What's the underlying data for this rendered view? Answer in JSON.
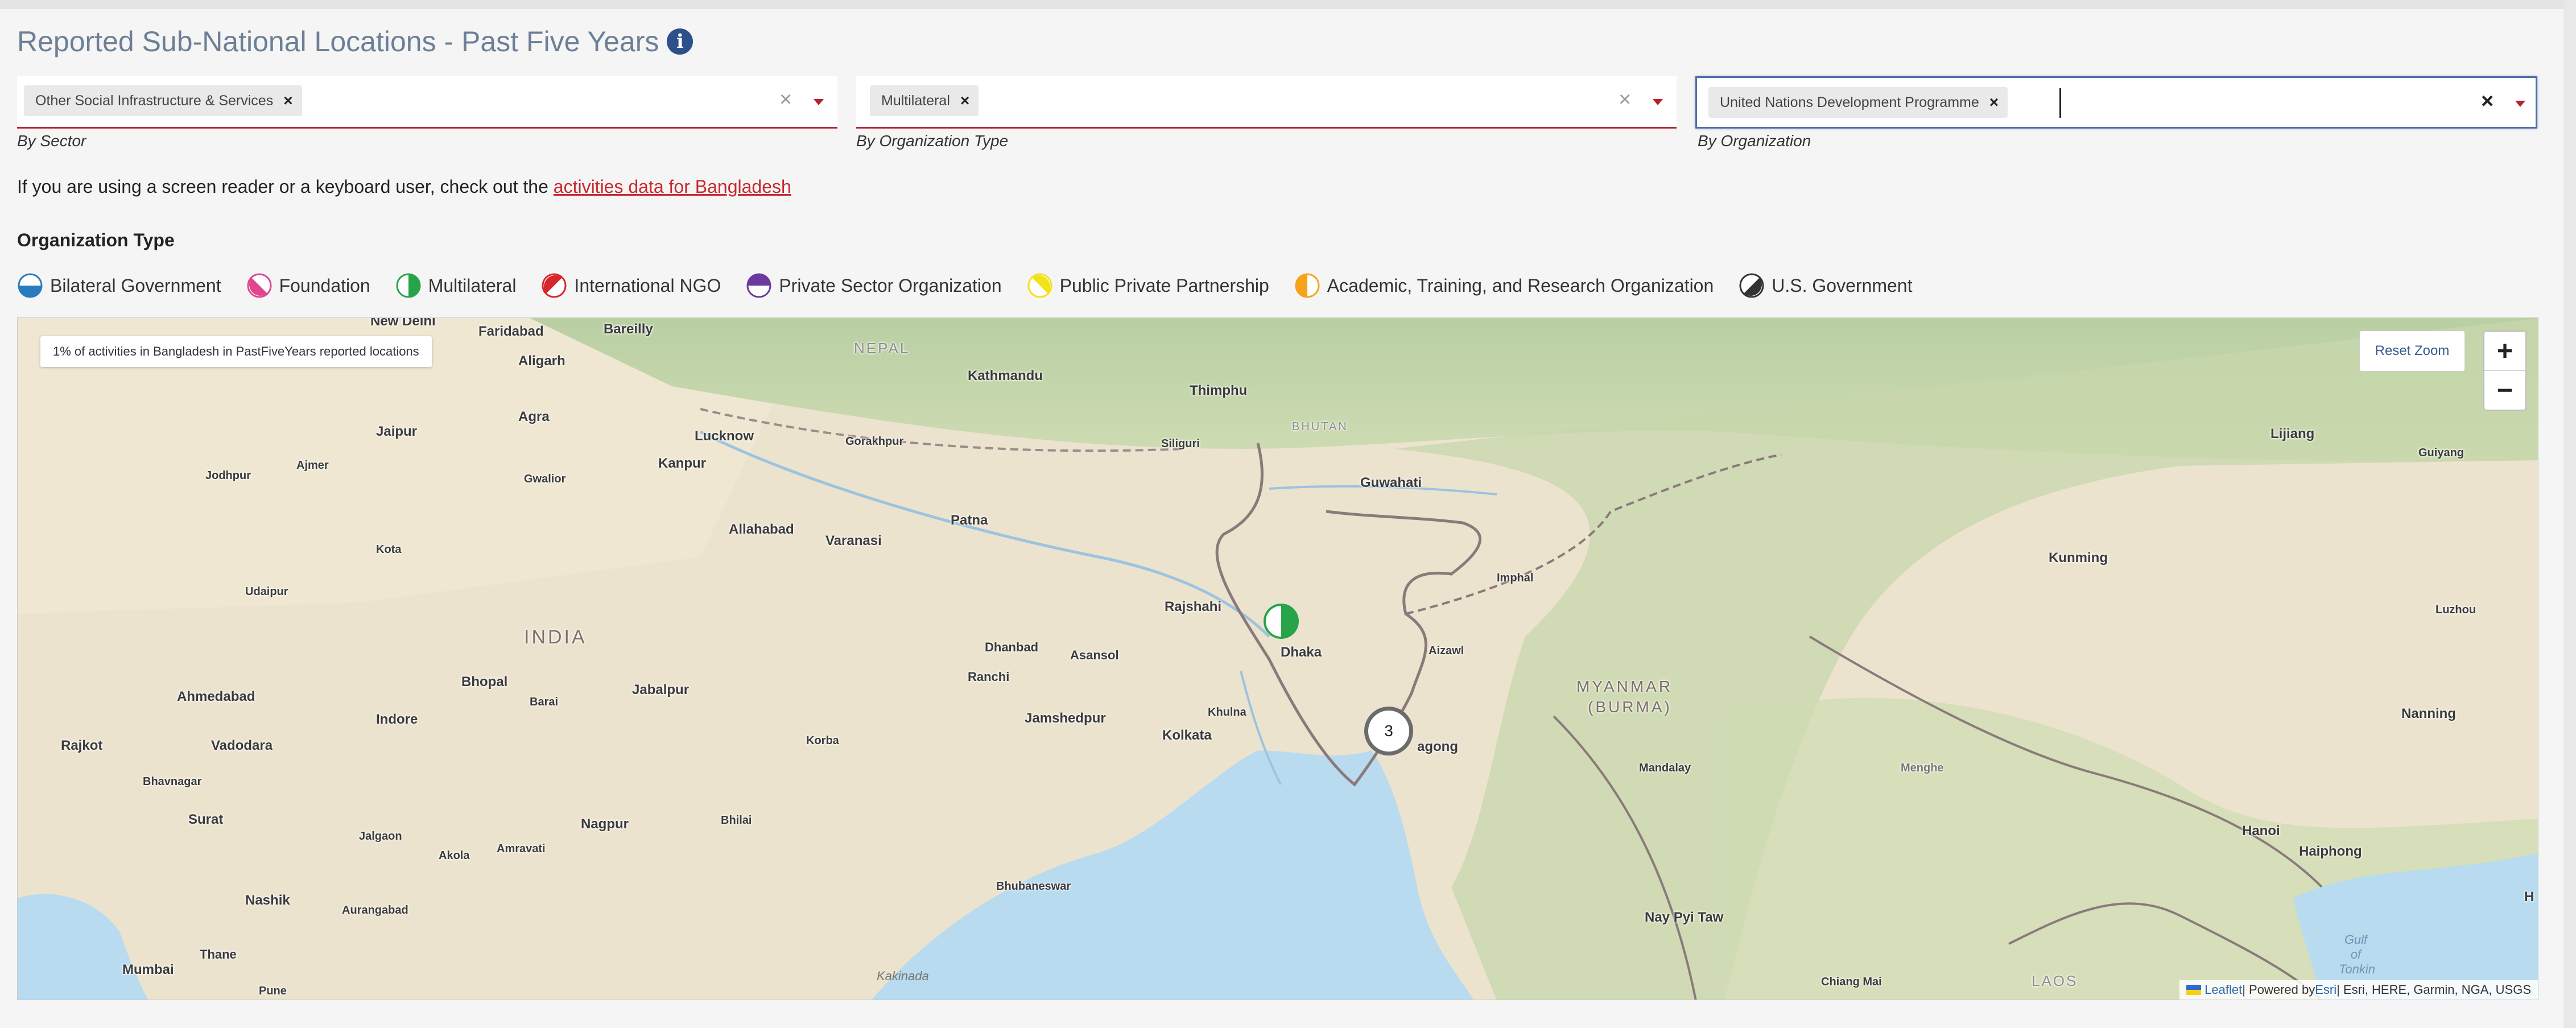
{
  "page": {
    "title": "Reported Sub-National Locations - Past Five Years",
    "info_icon": "info-icon"
  },
  "filters": [
    {
      "chip": "Other Social Infrastructure & Services",
      "label": "By Sector"
    },
    {
      "chip": "Multilateral",
      "label": "By Organization Type"
    },
    {
      "chip": "United Nations Development Programme",
      "label": "By Organization"
    }
  ],
  "chip_remove": "×",
  "clear_symbol": "×",
  "screen_reader": {
    "text": "If you are using a screen reader or a keyboard user, check out the ",
    "link": "activities data for Bangladesh"
  },
  "legend": {
    "heading": "Organization Type",
    "items": [
      {
        "label": "Bilateral Government",
        "color": "#2a7ac0"
      },
      {
        "label": "Foundation",
        "color": "#e0458f"
      },
      {
        "label": "Multilateral",
        "color": "#27a44a"
      },
      {
        "label": "International NGO",
        "color": "#d8262b"
      },
      {
        "label": "Private Sector Organization",
        "color": "#6b3a9e"
      },
      {
        "label": "Public Private Partnership",
        "color": "#f2e21a"
      },
      {
        "label": "Academic, Training, and Research Organization",
        "color": "#f4a41b"
      },
      {
        "label": "U.S. Government",
        "color": "#333333"
      }
    ]
  },
  "map": {
    "note": "1% of activities in Bangladesh in PastFiveYears reported locations",
    "reset_zoom": "Reset Zoom",
    "zoom_in": "+",
    "zoom_out": "−",
    "cluster_count": "3",
    "marker_type": "Multilateral",
    "attribution": {
      "leaflet": "Leaflet",
      "powered_prefix": " | Powered by ",
      "esri": "Esri",
      "sources": " | Esri, HERE, Garmin, NGA, USGS"
    },
    "places": {
      "new_delhi": "New Delhi",
      "faridabad": "Faridabad",
      "bareilly": "Bareilly",
      "aligarh": "Aligarh",
      "nepal": "NEPAL",
      "kathmandu": "Kathmandu",
      "thimphu": "Thimphu",
      "bhutan": "BHUTAN",
      "lijiang": "Lijiang",
      "guiyang": "Guiyang",
      "agra": "Agra",
      "jaipur": "Jaipur",
      "lucknow": "Lucknow",
      "gorakhpur": "Gorakhpur",
      "siliguri": "Siliguri",
      "guwahati": "Guwahati",
      "jodhpur": "Jodhpur",
      "ajmer": "Ajmer",
      "gwalior": "Gwalior",
      "kanpur": "Kanpur",
      "patna": "Patna",
      "allahabad": "Allahabad",
      "varanasi": "Varanasi",
      "kunming": "Kunming",
      "kota": "Kota",
      "imphal": "Imphal",
      "udaipur": "Udaipur",
      "rajshahi": "Rajshahi",
      "india": "INDIA",
      "dhanbad": "Dhanbad",
      "asansol": "Asansol",
      "dhaka": "Dhaka",
      "aizawl": "Aizawl",
      "luzhou": "Luzhou",
      "bhopal": "Bhopal",
      "ranchi": "Ranchi",
      "myanmar": "MYANMAR",
      "burma": "(BURMA)",
      "ahmedabad": "Ahmedabad",
      "jabalpur": "Jabalpur",
      "barai": "Barai",
      "khulna": "Khulna",
      "jamshedpur": "Jamshedpur",
      "indore": "Indore",
      "nanning": "Nanning",
      "kolkata": "Kolkata",
      "korba": "Korba",
      "rajkot": "Rajkot",
      "vadodara": "Vadodara",
      "chittagong_tail": "agong",
      "mandalay": "Mandalay",
      "menghe": "Menghe",
      "bhavnagar": "Bhavnagar",
      "surat": "Surat",
      "nagpur": "Nagpur",
      "bhilai": "Bhilai",
      "jalgaon": "Jalgaon",
      "akola": "Akola",
      "amravati": "Amravati",
      "hanoi": "Hanoi",
      "haiphong": "Haiphong",
      "bhubaneswar": "Bhubaneswar",
      "nashik": "Nashik",
      "aurangabad": "Aurangabad",
      "nay_pyi_taw": "Nay Pyi Taw",
      "thane": "Thane",
      "mumbai": "Mumbai",
      "pune": "Pune",
      "kakinada": "Kakinada",
      "chiang_mai": "Chiang Mai",
      "laos": "LAOS",
      "gulf_of_tonkin": "Gulf of Tonkin",
      "h_edge": "H"
    }
  }
}
